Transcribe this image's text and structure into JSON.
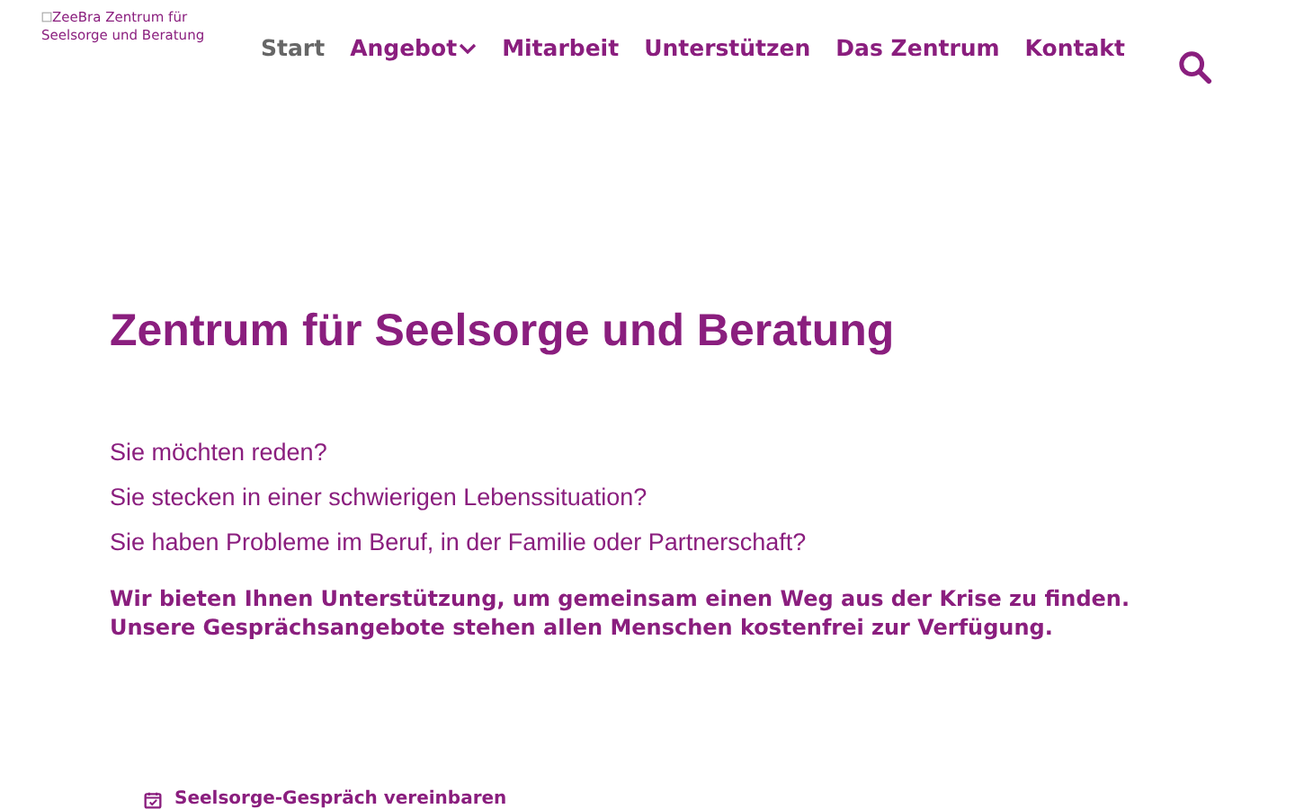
{
  "logo": {
    "alt_text": "ZeeBra Zentrum für Seelsorge und Beratung"
  },
  "nav": [
    {
      "label": "Start",
      "selected": true,
      "has_dropdown": false
    },
    {
      "label": "Angebot",
      "selected": false,
      "has_dropdown": true
    },
    {
      "label": "Mitarbeit",
      "selected": false,
      "has_dropdown": false
    },
    {
      "label": "Unterstützen",
      "selected": false,
      "has_dropdown": false
    },
    {
      "label": "Das Zentrum",
      "selected": false,
      "has_dropdown": false
    },
    {
      "label": "Kontakt",
      "selected": false,
      "has_dropdown": false
    }
  ],
  "hero": {
    "title": "Zentrum für Seelsorge und Beratung",
    "questions": [
      "Sie möchten reden?",
      "Sie stecken in einer schwierigen Lebenssituation?",
      "Sie haben Probleme im Beruf, in der Familie oder Partnerschaft?"
    ],
    "statements": [
      "Wir bieten Ihnen Unterstützung, um gemeinsam einen Weg aus der Krise zu finden.",
      "Unsere Gesprächsangebote stehen allen Menschen kostenfrei zur Verfügung."
    ]
  },
  "appointment_link": "Seelsorge-Gespräch vereinbaren"
}
